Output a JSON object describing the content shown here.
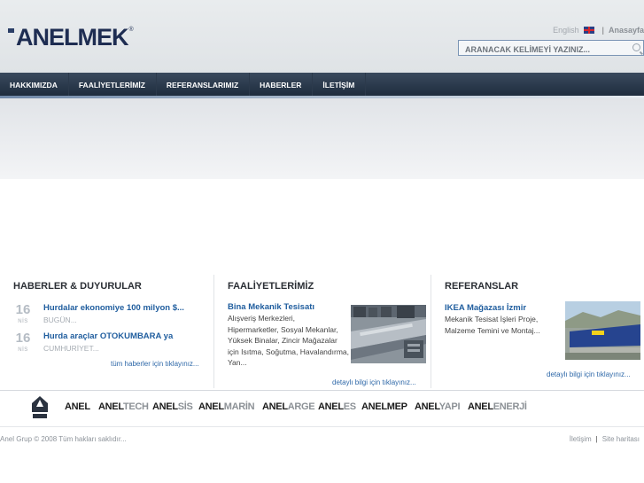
{
  "header": {
    "logo_text": "ANELMEK",
    "logo_reg": "®",
    "lang_label": "English",
    "home_label": "Anasayfa",
    "search_placeholder": "ARANACAK KELİMEYİ YAZINIZ..."
  },
  "nav": {
    "items": [
      {
        "label": "HAKKIMIZDA"
      },
      {
        "label": "FAALİYETLERİMİZ"
      },
      {
        "label": "REFERANSLARIMIZ"
      },
      {
        "label": "HABERLER"
      },
      {
        "label": "İLETİŞİM"
      }
    ]
  },
  "news": {
    "title": "HABERLER & DUYURULAR",
    "items": [
      {
        "day": "16",
        "month": "NİS",
        "title": "Hurdalar ekonomiye 100 milyon $...",
        "source": "BUGÜN..."
      },
      {
        "day": "16",
        "month": "NİS",
        "title": "Hurda araçlar OTOKUMBARA ya",
        "source": "CUMHURİYET..."
      }
    ],
    "more": "tüm haberler için tıklayınız..."
  },
  "activities": {
    "title": "FAALİYETLERİMİZ",
    "item_title": "Bina Mekanik Tesisatı",
    "lines": [
      "Alışveriş Merkezleri,",
      "Hipermarketler, Sosyal Mekanlar,",
      "Yüksek Binalar, Zincir Mağazalar",
      "için Isıtma, Soğutma, Havalandırma,",
      "Yan..."
    ],
    "more": "detaylı bilgi için tıklayınız..."
  },
  "references": {
    "title": "REFERANSLAR",
    "item_title": "IKEA Mağazası İzmir",
    "lines": [
      "Mekanik Tesisat İşleri Proje,",
      "Malzeme Temini ve Montaj..."
    ],
    "more": "detaylı bilgi için tıklayınız..."
  },
  "brands": [
    {
      "pre": "ANEL",
      "post": ""
    },
    {
      "pre": "ANEL",
      "post": "TECH"
    },
    {
      "pre": "ANEL",
      "post": "SİS"
    },
    {
      "pre": "ANEL",
      "post": "MARİN"
    },
    {
      "pre": "ANEL",
      "post": "ARGE"
    },
    {
      "pre": "ANEL",
      "post": "ES"
    },
    {
      "pre": "ANEL",
      "post": "MEP"
    },
    {
      "pre": "ANEL",
      "post": "YAPI"
    },
    {
      "pre": "ANEL",
      "post": "ENERJİ"
    }
  ],
  "footer": {
    "copyright": "Anel Grup © 2008 Tüm hakları saklıdır...",
    "contact": "İletişim",
    "sitemap": "Site haritası"
  },
  "colors": {
    "nav_bg": "#1c2a3b",
    "link_blue": "#1f5d9e",
    "logo_navy": "#1e2d52"
  }
}
